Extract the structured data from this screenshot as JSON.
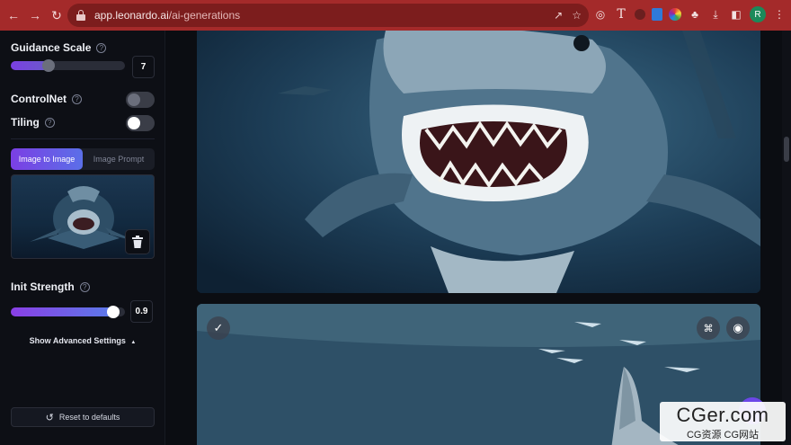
{
  "browser": {
    "url_host": "app.leonardo.ai",
    "url_path": "/ai-generations",
    "profile_initial": "R"
  },
  "sidebar": {
    "guidance_scale": {
      "label": "Guidance Scale",
      "value": "7",
      "level": 0.33
    },
    "controlnet": {
      "label": "ControlNet",
      "enabled": false
    },
    "tiling": {
      "label": "Tiling",
      "enabled": false
    },
    "tabs": [
      {
        "label": "Image to Image",
        "active": true
      },
      {
        "label": "Image Prompt",
        "active": false
      }
    ],
    "init_strength": {
      "label": "Init Strength",
      "value": "0.9",
      "level": 0.9
    },
    "advanced_label": "Show Advanced Settings",
    "reset_label": "Reset to defaults"
  },
  "watermark": {
    "title": "CGer.com",
    "subtitle": "CG资源 CG网站"
  },
  "colors": {
    "accent_purple": "#7b3fe4",
    "accent_blue": "#5b6fe8",
    "chrome_red": "#a42a2a"
  }
}
